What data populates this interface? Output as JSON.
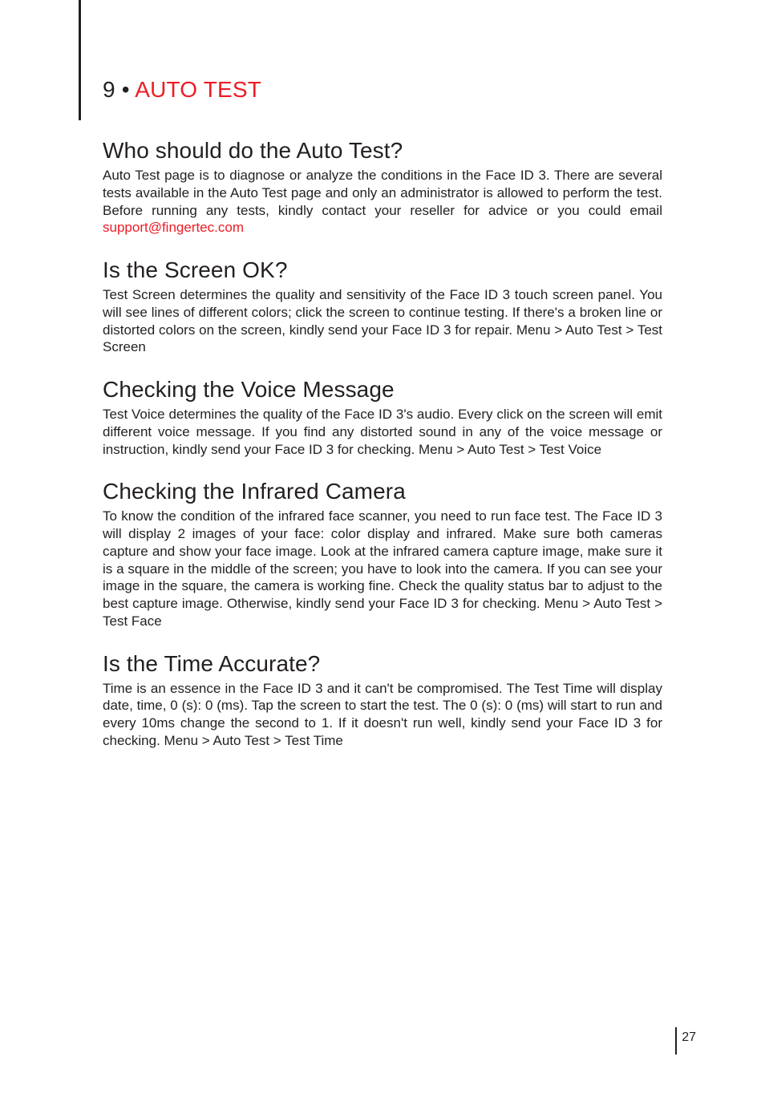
{
  "chapter": {
    "number": "9 •",
    "title": "AUTO TEST"
  },
  "sections": {
    "who": {
      "heading": "Who should do the Auto Test?",
      "body_before_link": "Auto Test page is to diagnose or analyze the conditions in the Face ID 3. There are several tests available in the Auto Test page and only an administrator is allowed to perform the test. Before running any tests, kindly contact your reseller for advice or you could email ",
      "link_text": "support@fingertec.com"
    },
    "screen": {
      "heading": "Is the Screen OK?",
      "body": "Test Screen determines the quality and sensitivity of the Face ID 3 touch screen panel. You will see lines of different colors; click the screen to continue testing. If there's a broken line or distorted colors on the screen, kindly send your Face ID 3 for repair. Menu > Auto Test > Test Screen"
    },
    "voice": {
      "heading": "Checking the Voice Message",
      "body": "Test Voice determines the quality of the Face ID 3's audio. Every click on the screen will emit different voice message. If you find any distorted sound in any of the voice message or instruction, kindly send your Face ID 3 for checking. Menu > Auto Test > Test Voice"
    },
    "camera": {
      "heading": "Checking the Infrared Camera",
      "body": "To know the condition of the infrared face scanner, you need to run face test. The Face ID 3 will display 2 images of your face: color display and infrared. Make sure both cameras capture and show your face image. Look at the infrared camera capture image, make sure it is a square in the middle of the screen; you have to look into the camera. If you can see your image in the square, the camera is working fine. Check the quality status bar to adjust to the best capture image. Otherwise, kindly send your Face ID 3 for checking. Menu > Auto Test > Test Face"
    },
    "time": {
      "heading": "Is the Time Accurate?",
      "body": "Time is an essence in the Face ID 3 and it can't be compromised. The Test Time will display date, time, 0 (s): 0 (ms). Tap the screen to start the test. The 0 (s): 0 (ms) will start to run and every 10ms change the second to 1. If it doesn't run well, kindly send your Face ID  3 for checking. Menu > Auto Test  > Test Time"
    }
  },
  "page_number": "27"
}
